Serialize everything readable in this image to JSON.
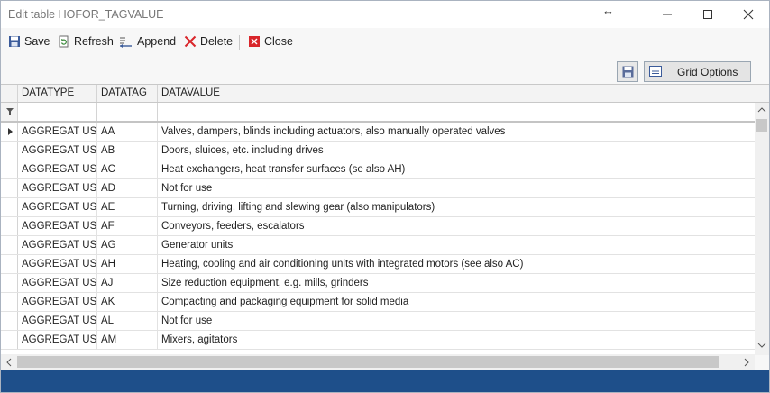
{
  "window": {
    "title": "Edit table HOFOR_TAGVALUE",
    "resize_glyph": "↔"
  },
  "toolbar": {
    "save": "Save",
    "refresh": "Refresh",
    "append": "Append",
    "delete": "Delete",
    "close": "Close"
  },
  "options": {
    "grid_options": "Grid Options"
  },
  "grid": {
    "columns": [
      "DATATYPE",
      "DATATAG",
      "DATAVALUE"
    ],
    "rows": [
      [
        "AGGREGAT US",
        "AA",
        "Valves, dampers, blinds including actuators, also manually operated valves"
      ],
      [
        "AGGREGAT US",
        "AB",
        "Doors, sluices, etc. including drives"
      ],
      [
        "AGGREGAT US",
        "AC",
        "Heat exchangers, heat transfer surfaces (se also AH)"
      ],
      [
        "AGGREGAT US",
        "AD",
        "Not for use"
      ],
      [
        "AGGREGAT US",
        "AE",
        "Turning, driving, lifting and slewing gear (also manipulators)"
      ],
      [
        "AGGREGAT US",
        "AF",
        "Conveyors, feeders, escalators"
      ],
      [
        "AGGREGAT US",
        "AG",
        "Generator units"
      ],
      [
        "AGGREGAT US",
        "AH",
        "Heating, cooling and air conditioning units with integrated motors (see also AC)"
      ],
      [
        "AGGREGAT US",
        "AJ",
        "Size reduction equipment, e.g. mills, grinders"
      ],
      [
        "AGGREGAT US",
        "AK",
        "Compacting and packaging equipment for solid media"
      ],
      [
        "AGGREGAT US",
        "AL",
        "Not for use"
      ],
      [
        "AGGREGAT US",
        "AM",
        "Mixers, agitators"
      ]
    ]
  },
  "colors": {
    "statusbar": "#1e4f8a",
    "save_icon": "#3b5b9a",
    "delete_icon": "#d9262b",
    "close_icon": "#d9262b"
  }
}
